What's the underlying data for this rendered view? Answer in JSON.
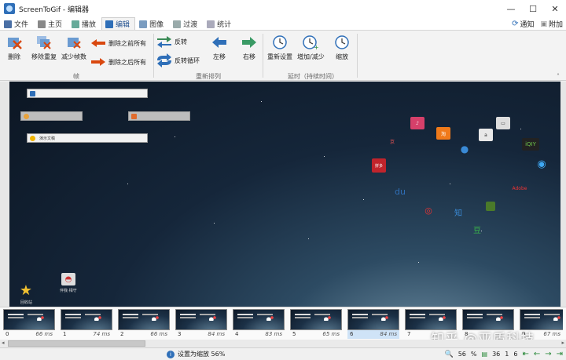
{
  "window": {
    "title": "ScreenToGif - 编辑器",
    "controls": [
      "minimize-icon",
      "maximize-icon",
      "close-icon"
    ]
  },
  "tabs": [
    {
      "label": "文件",
      "icon": "save-icon"
    },
    {
      "label": "主页",
      "icon": "home-icon"
    },
    {
      "label": "播放",
      "icon": "play-icon"
    },
    {
      "label": "编辑",
      "icon": "pen-icon",
      "active": true
    },
    {
      "label": "图像",
      "icon": "image-icon"
    },
    {
      "label": "过渡",
      "icon": "transition-icon"
    },
    {
      "label": "统计",
      "icon": "stats-icon"
    }
  ],
  "tabbar_right": {
    "notify": "通知",
    "extra": "附加"
  },
  "ribbon": {
    "frames_group": {
      "label": "帧",
      "delete": "删除",
      "remove_dup": "移除重复",
      "reduce": "减少帧数",
      "delete_before": "删除之前所有",
      "delete_after": "删除之后所有"
    },
    "reorder_group": {
      "label": "重新排列",
      "reverse": "反转",
      "yoyo": "反转循环",
      "move_left": "左移",
      "move_right": "右移"
    },
    "delay_group": {
      "label": "延时（持续时间）",
      "override": "重新设置",
      "increase": "增加/减少",
      "scale": "缩放"
    }
  },
  "canvas": {
    "search_bar_text": "",
    "bar3_text": "演示文稿",
    "desk_label_1": "回收站",
    "desk_label_2": "伴我·相守"
  },
  "frames": [
    {
      "index": "0",
      "ms": "66 ms"
    },
    {
      "index": "1",
      "ms": "74 ms"
    },
    {
      "index": "2",
      "ms": "66 ms"
    },
    {
      "index": "3",
      "ms": "84 ms"
    },
    {
      "index": "4",
      "ms": "83 ms"
    },
    {
      "index": "5",
      "ms": "65 ms"
    },
    {
      "index": "6",
      "ms": "84 ms",
      "selected": true
    },
    {
      "index": "7",
      "ms": ""
    },
    {
      "index": "8",
      "ms": ""
    },
    {
      "index": "9",
      "ms": "67 ms"
    }
  ],
  "status": {
    "message": "设置为缩放 56%",
    "zoom": "56",
    "percent": "%",
    "frame_count": "36",
    "selected_count": "1",
    "current_frame": "6"
  },
  "watermark": "知乎 @亚盾科技",
  "colors": {
    "accent": "#2f6fb8",
    "nav_green": "#2a8a3a",
    "delete_red": "#d9480f"
  }
}
